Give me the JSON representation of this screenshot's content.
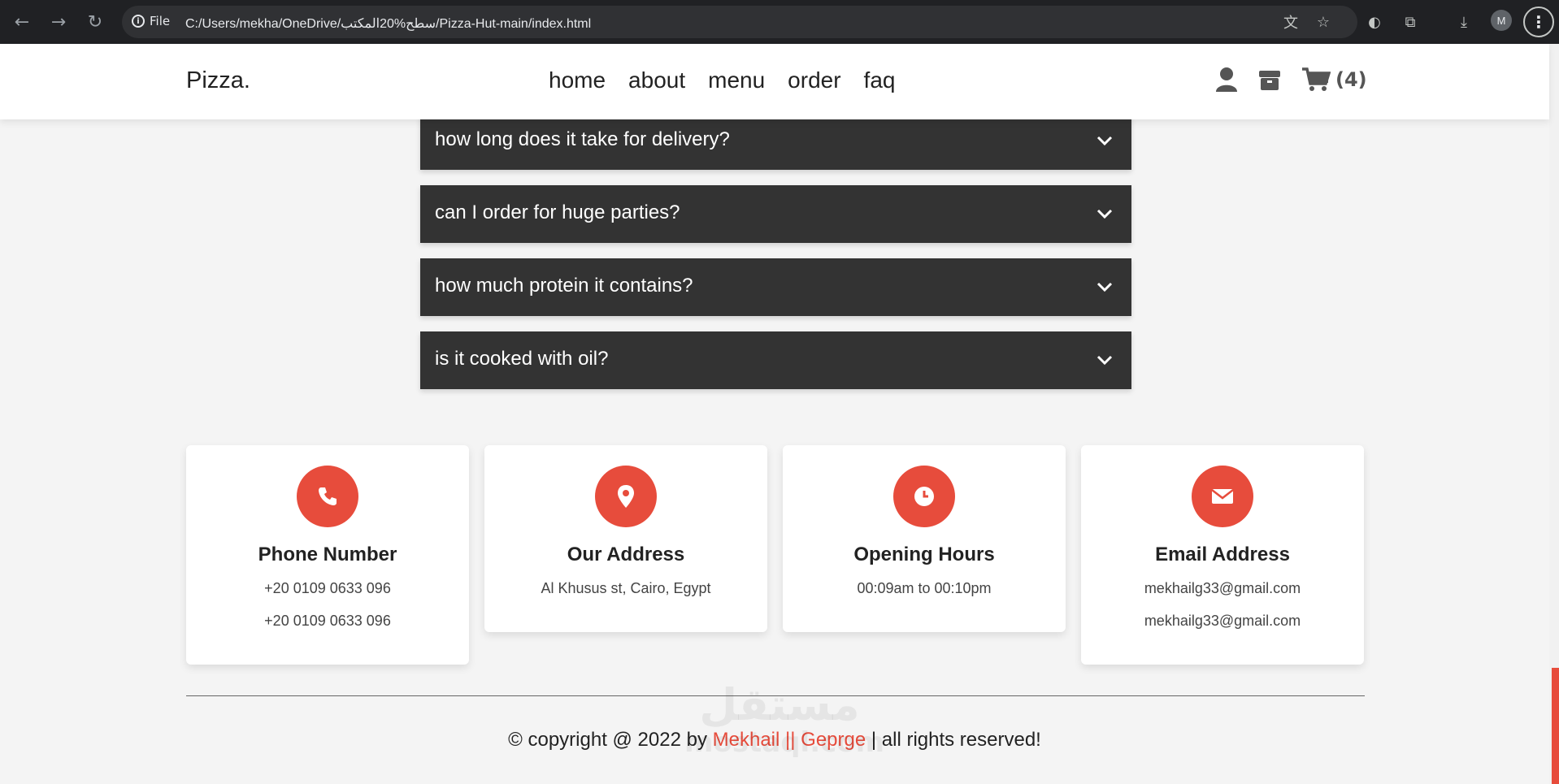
{
  "browser": {
    "site_info_label": "File",
    "url": "C:/Users/mekha/OneDrive/سطح%20المكتب/Pizza-Hut-main/index.html",
    "profile_initial": "M"
  },
  "header": {
    "logo": "Pizza.",
    "nav": [
      "home",
      "about",
      "menu",
      "order",
      "faq"
    ],
    "cart_count": "(4)"
  },
  "faq": {
    "questions": [
      "how long does it take for delivery?",
      "can I order for huge parties?",
      "how much protein it contains?",
      "is it cooked with oil?"
    ]
  },
  "contact": {
    "cards": [
      {
        "icon": "phone-icon",
        "title": "Phone Number",
        "lines": [
          "+20 0109 0633 096",
          "+20 0109 0633 096"
        ]
      },
      {
        "icon": "map-marker-icon",
        "title": "Our Address",
        "lines": [
          "Al Khusus st, Cairo, Egypt"
        ]
      },
      {
        "icon": "clock-icon",
        "title": "Opening Hours",
        "lines": [
          "00:09am to 00:10pm"
        ]
      },
      {
        "icon": "envelope-icon",
        "title": "Email Address",
        "lines": [
          "mekhailg33@gmail.com",
          "mekhailg33@gmail.com"
        ]
      }
    ],
    "accent_color": "#e74c3c"
  },
  "footer": {
    "credit_prefix": "© copyright @ 2022 by ",
    "credit_author": "Mekhail || Geprge",
    "credit_suffix": " | all rights reserved!"
  },
  "watermark": {
    "line1": "مستقل",
    "line2": "mostaql.com"
  }
}
